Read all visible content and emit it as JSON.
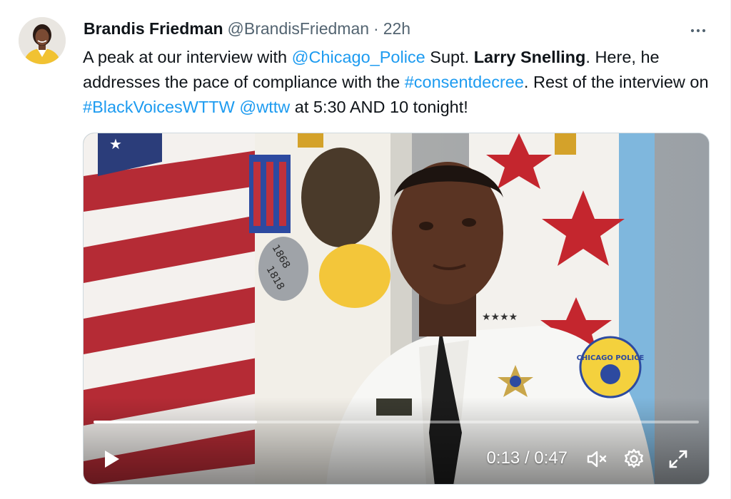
{
  "author": {
    "name": "Brandis Friedman",
    "handle": "@BrandisFriedman",
    "separator": "·",
    "time": "22h"
  },
  "tweet": {
    "t1": "A peak at our interview with ",
    "m1": "@Chicago_Police",
    "t2": " Supt. ",
    "b1": "Larry Snelling",
    "t3": ". Here, he addresses the pace of compliance with the ",
    "h1": "#consentdecree",
    "t4": ". Rest of the interview on ",
    "h2": "#BlackVoicesWTTW",
    "t5": " ",
    "m2": "@wttw",
    "t6": " at 5:30 AND 10 tonight!"
  },
  "video": {
    "current_time": "0:13",
    "time_sep": "/",
    "duration": "0:47",
    "progress": 0.27,
    "badge_text": "CHICAGO POLICE",
    "seal_years": [
      "1868",
      "1818"
    ]
  },
  "icons": {
    "more": "more-horizontal-icon",
    "play": "play-icon",
    "mute": "volume-muted-icon",
    "settings": "gear-icon",
    "fullscreen": "fullscreen-icon"
  },
  "colors": {
    "link": "#1d9bf0",
    "text": "#0f1419",
    "secondary": "#536471"
  }
}
